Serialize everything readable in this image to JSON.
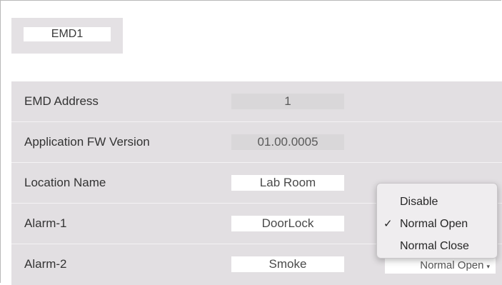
{
  "tab": {
    "label": "EMD1"
  },
  "rows": [
    {
      "label": "EMD Address",
      "value": "1"
    },
    {
      "label": "Application FW Version",
      "value": "01.00.0005"
    },
    {
      "label": "Location Name",
      "value": "Lab Room"
    },
    {
      "label": "Alarm-1",
      "value": "DoorLock"
    },
    {
      "label": "Alarm-2",
      "value": "Smoke",
      "select_value": "Normal Open"
    }
  ],
  "dropdown": {
    "options": [
      "Disable",
      "Normal Open",
      "Normal Close"
    ],
    "selected": "Normal Open",
    "check_glyph": "✓",
    "arrow_glyph": "▾"
  }
}
